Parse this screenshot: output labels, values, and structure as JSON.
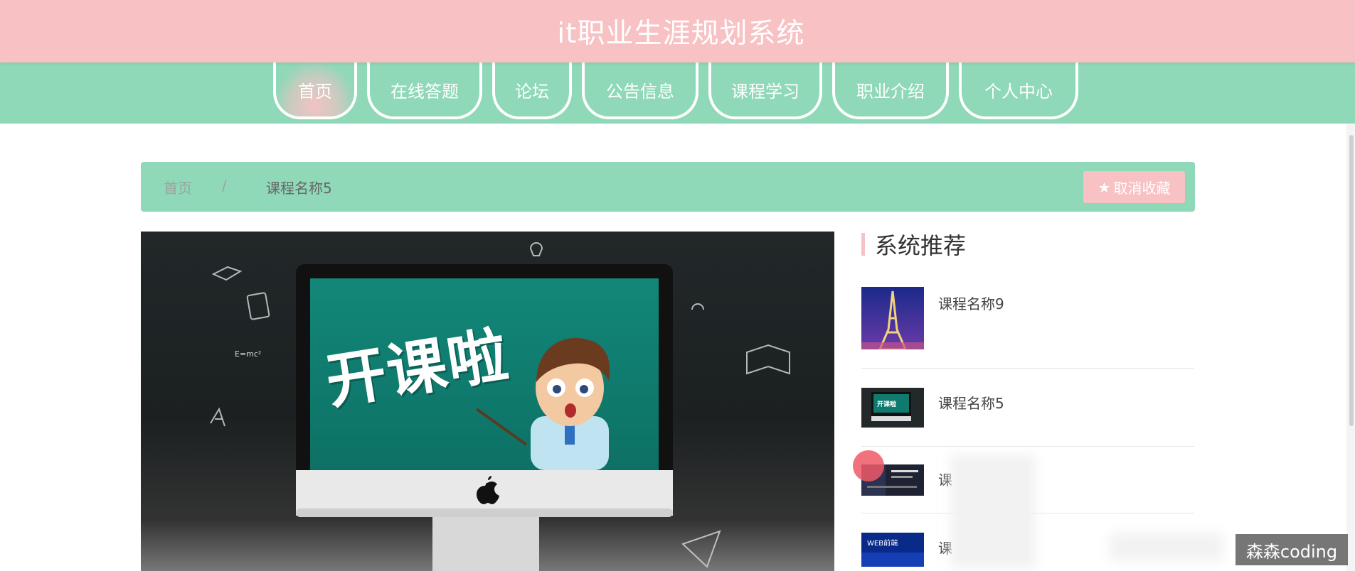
{
  "header": {
    "title": "it职业生涯规划系统"
  },
  "nav": {
    "items": [
      {
        "label": "首页",
        "active": true
      },
      {
        "label": "在线答题"
      },
      {
        "label": "论坛"
      },
      {
        "label": "公告信息"
      },
      {
        "label": "课程学习"
      },
      {
        "label": "职业介绍"
      },
      {
        "label": "个人中心"
      }
    ]
  },
  "breadcrumb": {
    "home": "首页",
    "separator": "/",
    "current": "课程名称5"
  },
  "actions": {
    "unfavorite_label": "取消收藏",
    "unfavorite_icon": "star-icon"
  },
  "hero": {
    "image_text": "开课啦",
    "formula_text": "E=mc²"
  },
  "recommend": {
    "title": "系统推荐",
    "items": [
      {
        "name": "课程名称9",
        "thumb": "eiffel-tower-night"
      },
      {
        "name": "课程名称5",
        "thumb": "classroom-screen"
      },
      {
        "name": "课",
        "thumb": "dark-banner"
      },
      {
        "name": "课",
        "thumb": "web-blue-banner",
        "thumb_text": "WEB前端"
      }
    ]
  },
  "watermark": "森森coding",
  "colors": {
    "header_bg": "#f8c1c4",
    "nav_bg": "#8fd8b8",
    "accent_pink": "#f8c1c4"
  }
}
